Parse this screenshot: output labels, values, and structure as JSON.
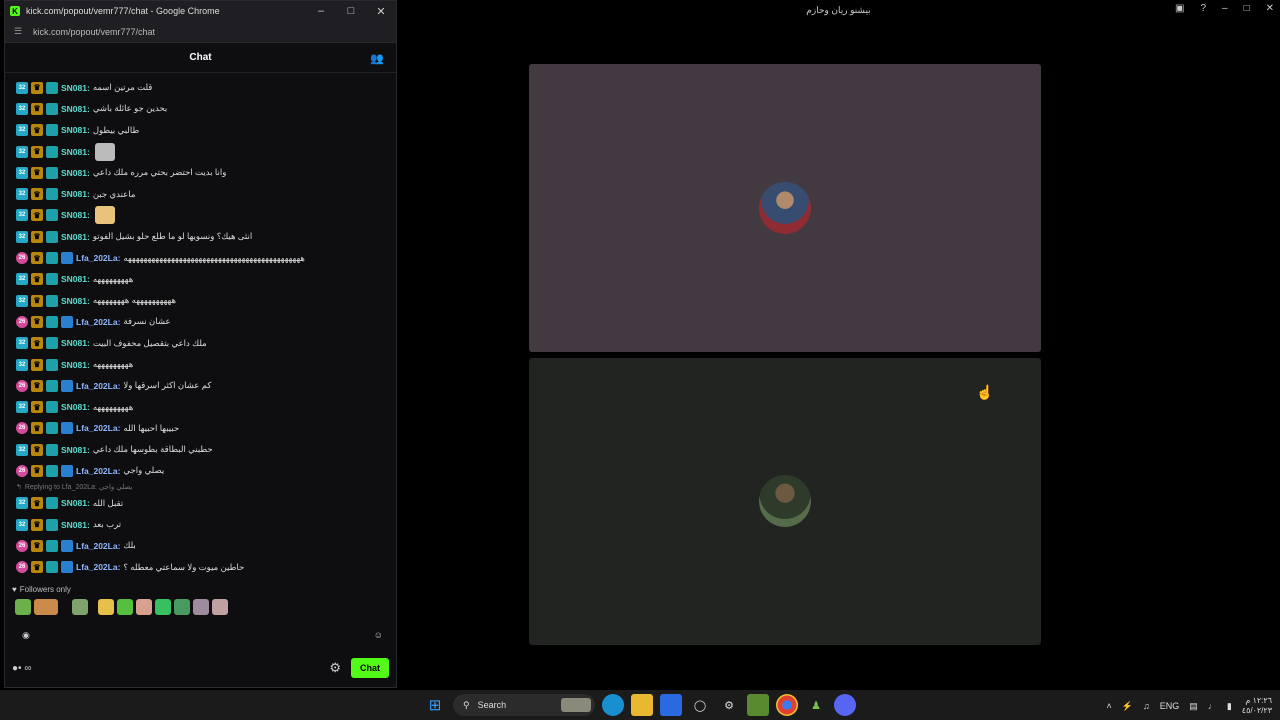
{
  "popout": {
    "window_title": "kick.com/popout/vemr777/chat - Google Chrome",
    "logo": "K",
    "url": "kick.com/popout/vemr777/chat",
    "chat_title": "Chat",
    "messages": [
      {
        "user": "SN081:",
        "text": "قلت مرتين اسمه",
        "type": "sn"
      },
      {
        "user": "SN081:",
        "text": "بحدين جو عائلة باشي",
        "type": "sn"
      },
      {
        "user": "SN081:",
        "text": "طالبي بيطول",
        "type": "sn"
      },
      {
        "user": "SN081:",
        "text": "",
        "type": "sn",
        "emote": true
      },
      {
        "user": "SN081:",
        "text": "وانا بديت احتضر بحتي مرره ملك داعي",
        "type": "sn"
      },
      {
        "user": "SN081:",
        "text": "ماعندي جبن",
        "type": "sn"
      },
      {
        "user": "SN081:",
        "text": "",
        "type": "sn",
        "emote": true
      },
      {
        "user": "SN081:",
        "text": "انثى هيك؟ ونسويها لو ما طلع حلو بشيل الفوتو",
        "type": "sn"
      },
      {
        "user": "Lfa_202La:",
        "text": "هههههههههههههههههههههههههههههههههههههههههههههه",
        "type": "lfa"
      },
      {
        "user": "SN081:",
        "text": "هههههههههه",
        "type": "sn"
      },
      {
        "user": "SN081:",
        "text": "ههههههههههه ههههههههه",
        "type": "sn"
      },
      {
        "user": "Lfa_202La:",
        "text": "عشان نسرفة",
        "type": "lfa"
      },
      {
        "user": "SN081:",
        "text": "ملك داعي بتقصيل محفوف البيت",
        "type": "sn"
      },
      {
        "user": "SN081:",
        "text": "هههههههههه",
        "type": "sn"
      },
      {
        "user": "Lfa_202La:",
        "text": "كم عشان اكثر اسرقها ولا",
        "type": "lfa"
      },
      {
        "user": "SN081:",
        "text": "هههههههههه",
        "type": "sn"
      },
      {
        "user": "Lfa_202La:",
        "text": "حبيبها احبيها الله",
        "type": "lfa"
      },
      {
        "user": "SN081:",
        "text": "حطبني البطاقة بطوسها ملك داعي",
        "type": "sn"
      },
      {
        "user": "Lfa_202La:",
        "text": "يصلي واجي",
        "type": "lfa"
      }
    ],
    "reply_hint": "Replying to Lfa_202La: يصلي واجي",
    "messages_after_reply": [
      {
        "user": "SN081:",
        "text": "تقبل الله",
        "type": "sn"
      },
      {
        "user": "SN081:",
        "text": "ترب بعد",
        "type": "sn"
      },
      {
        "user": "Lfa_202La:",
        "text": "بلك",
        "type": "lfa"
      },
      {
        "user": "Lfa_202La:",
        "text": "حاطين ميوت ولا سماعتي معطله ؟",
        "type": "lfa"
      }
    ],
    "followers_only": "Followers only",
    "chat_button": "Chat",
    "badge_sub_months": "32",
    "badge_sub_months_alt": "26"
  },
  "main": {
    "tab_title": "بيشنو ريان وحازم"
  },
  "taskbar": {
    "search_label": "Search",
    "lang": "ENG",
    "time": "١٢:٢٦ م",
    "date": "٤٥/٠٢/٢٣"
  },
  "colors": {
    "kick_green": "#53fc18",
    "tile1_bg": "#433a41",
    "tile2_bg": "#222421"
  }
}
